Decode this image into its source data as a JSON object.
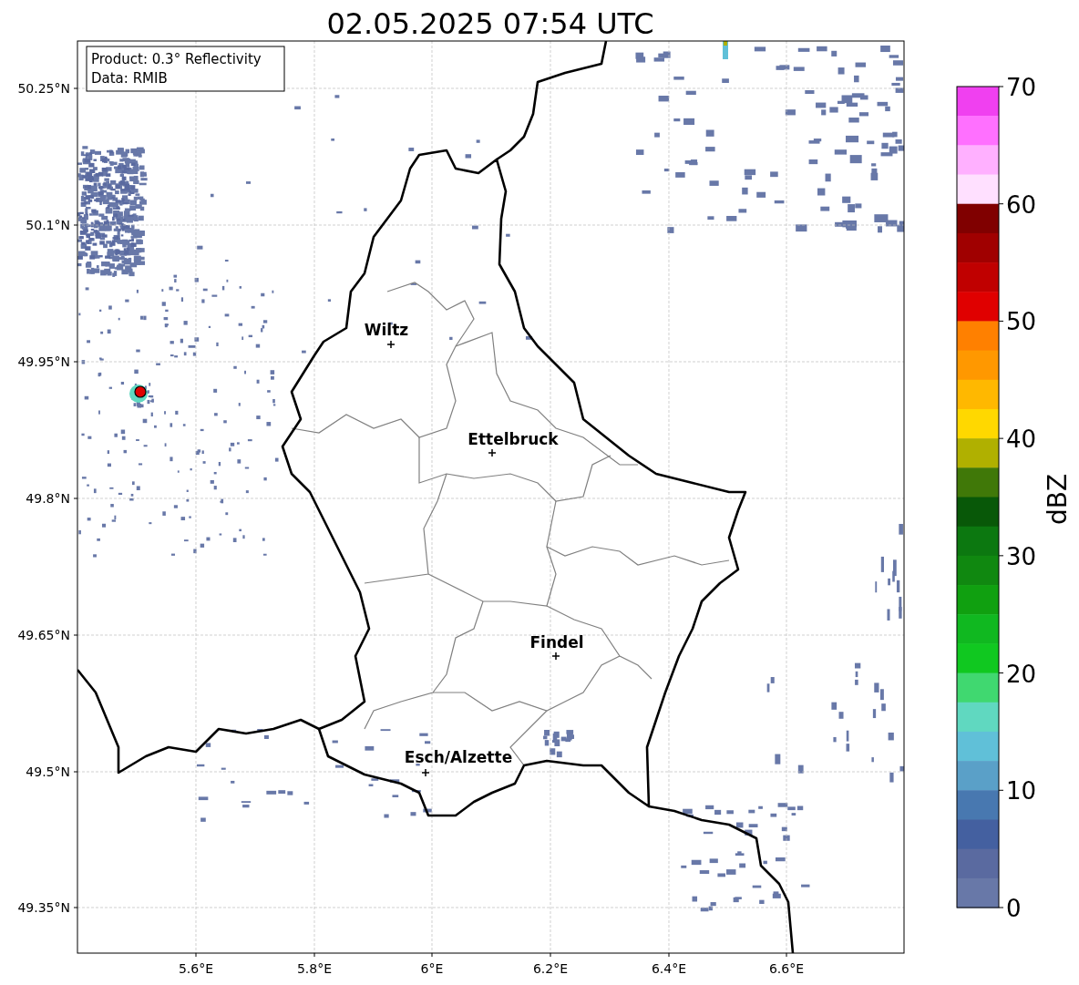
{
  "title": "02.05.2025 07:54 UTC",
  "map": {
    "info_box": [
      "Product: 0.3° Reflectivity",
      "Data: RMIB"
    ],
    "lat_ticks": [
      "50.25°N",
      "50.1°N",
      "49.95°N",
      "49.8°N",
      "49.65°N",
      "49.5°N",
      "49.35°N"
    ],
    "lon_ticks": [
      "5.6°E",
      "5.8°E",
      "6°E",
      "6.2°E",
      "6.4°E",
      "6.6°E"
    ],
    "cities": [
      {
        "name": "Wiltz"
      },
      {
        "name": "Ettelbruck"
      },
      {
        "name": "Findel"
      },
      {
        "name": "Esch/Alzette"
      }
    ]
  },
  "colorbar": {
    "label": "dBZ",
    "ticks": [
      "70",
      "60",
      "50",
      "40",
      "30",
      "20",
      "10",
      "0"
    ],
    "bins": [
      {
        "color": "#f040f0"
      },
      {
        "color": "#ff70ff"
      },
      {
        "color": "#ffb0ff"
      },
      {
        "color": "#ffe0ff"
      },
      {
        "color": "#800000"
      },
      {
        "color": "#a00000"
      },
      {
        "color": "#c00000"
      },
      {
        "color": "#e00000"
      },
      {
        "color": "#ff8000"
      },
      {
        "color": "#ff9800"
      },
      {
        "color": "#ffb800"
      },
      {
        "color": "#ffd800"
      },
      {
        "color": "#b0b000"
      },
      {
        "color": "#407808"
      },
      {
        "color": "#085808"
      },
      {
        "color": "#0c7810"
      },
      {
        "color": "#108810"
      },
      {
        "color": "#10a010"
      },
      {
        "color": "#10b820"
      },
      {
        "color": "#10c820"
      },
      {
        "color": "#40d870"
      },
      {
        "color": "#60d8c0"
      },
      {
        "color": "#60c0d8"
      },
      {
        "color": "#5aa0c8"
      },
      {
        "color": "#4878b0"
      },
      {
        "color": "#4460a0"
      },
      {
        "color": "#5a6aa0"
      },
      {
        "color": "#6878a8"
      }
    ]
  }
}
